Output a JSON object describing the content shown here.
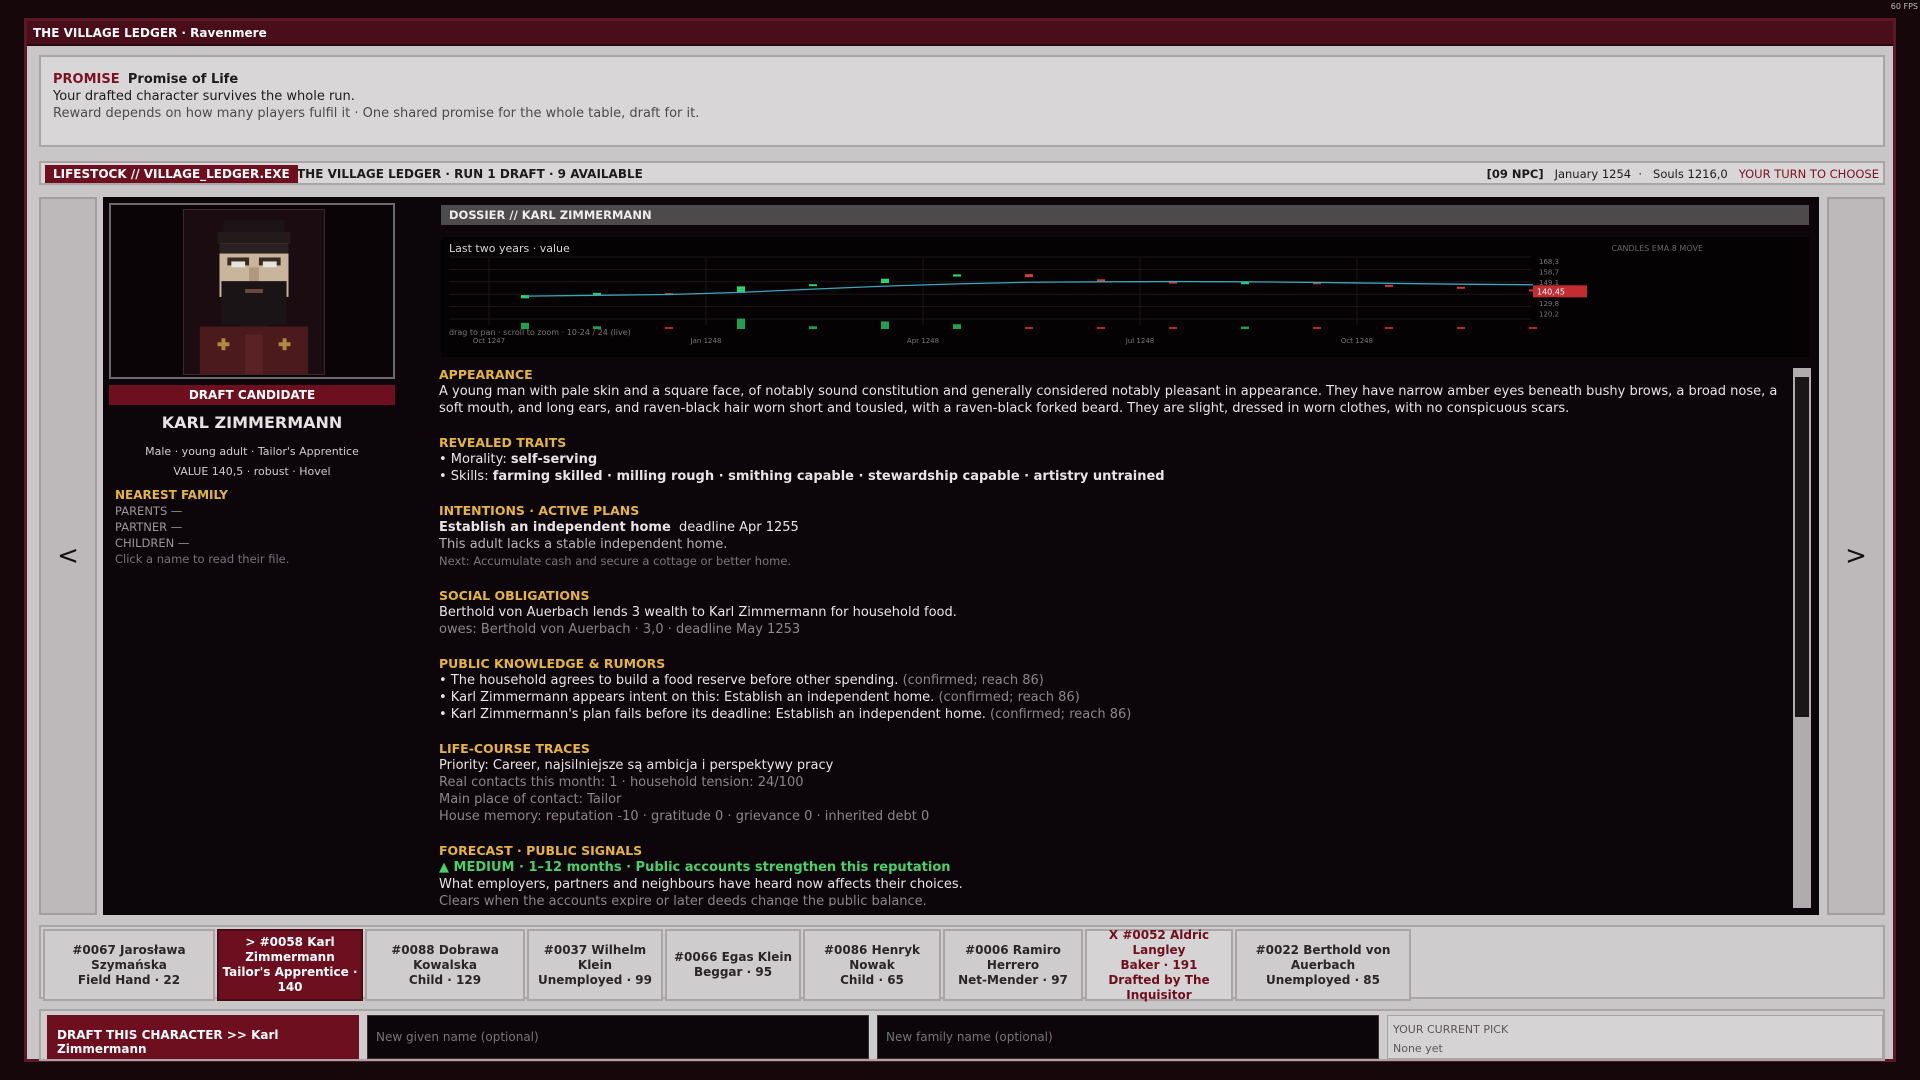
{
  "window": {
    "title": "THE VILLAGE LEDGER · Ravenmere",
    "fps": "60 FPS"
  },
  "promise": {
    "keyword": "PROMISE",
    "title": "Promise of Life",
    "line1": "Your drafted character survives the whole run.",
    "line2": "Reward depends on how many players fulfil it · One shared promise for the whole table, draft for it."
  },
  "status": {
    "exe": "LIFESTOCK // VILLAGE_LEDGER.EXE",
    "run": "THE VILLAGE LEDGER · RUN 1 DRAFT · 9 AVAILABLE",
    "npc": "[09 NPC]",
    "date": "January 1254",
    "souls": "Souls 1216,0",
    "turn": "YOUR TURN TO CHOOSE"
  },
  "nav": {
    "prev": "<",
    "next": ">"
  },
  "candidate": {
    "badge": "DRAFT CANDIDATE",
    "name": "KARL ZIMMERMANN",
    "meta1": "Male · young adult · Tailor's Apprentice",
    "meta2": "VALUE 140,5 · robust · Hovel",
    "family_head": "NEAREST FAMILY",
    "parents": "PARENTS —",
    "partner": "PARTNER —",
    "children": "CHILDREN —",
    "hint": "Click a name to read their file."
  },
  "dossier": {
    "header": "DOSSIER // KARL ZIMMERMANN"
  },
  "chart_data": {
    "type": "candlestick",
    "title": "Last two years · value",
    "modes": "CANDLES  EMA 8  MOVE",
    "x_ticks": [
      "Oct 1247",
      "Jan 1248",
      "Apr 1248",
      "Jul 1248",
      "Oct 1248"
    ],
    "y_ticks": [
      "168,3",
      "158,7",
      "149,1",
      "129,8",
      "120,2"
    ],
    "current_value_label": "140,45",
    "ylim": [
      115,
      172
    ],
    "footer": "drag to pan · scroll to zoom · 10-24 / 24 (live)",
    "candles": [
      {
        "dir": "up",
        "open": 134,
        "close": 137
      },
      {
        "dir": "up",
        "open": 138.5,
        "close": 139
      },
      {
        "dir": "down",
        "open": 138.8,
        "close": 138.4
      },
      {
        "dir": "up",
        "open": 139,
        "close": 145
      },
      {
        "dir": "up",
        "open": 146.5,
        "close": 147
      },
      {
        "dir": "up",
        "open": 148,
        "close": 152
      },
      {
        "dir": "up",
        "open": 154,
        "close": 156
      },
      {
        "dir": "down",
        "open": 156.3,
        "close": 153.5
      },
      {
        "dir": "down",
        "open": 151.5,
        "close": 150
      },
      {
        "dir": "down",
        "open": 149.4,
        "close": 148.6
      },
      {
        "dir": "up",
        "open": 148.5,
        "close": 148.8
      },
      {
        "dir": "down",
        "open": 148.8,
        "close": 147.2
      },
      {
        "dir": "down",
        "open": 146.4,
        "close": 145.8
      },
      {
        "dir": "down",
        "open": 144.6,
        "close": 143.2
      },
      {
        "dir": "down",
        "open": 142.2,
        "close": 141.4
      }
    ],
    "ema": [
      136,
      136.8,
      137.5,
      139.5,
      142.5,
      145.2,
      147.3,
      148.8,
      149.2,
      149.4,
      149.2,
      148.6,
      147.8,
      147,
      146.5
    ]
  },
  "sections": {
    "appearance": {
      "head": "APPEARANCE",
      "text": "A young man with pale skin and a square face, of notably sound constitution and generally considered notably pleasant in appearance. They have narrow amber eyes beneath bushy brows, a broad nose, a soft mouth, and long ears, and raven-black hair worn short and tousled, with a raven-black forked beard. They are slight, dressed in worn clothes, with no conspicuous scars."
    },
    "traits": {
      "head": "REVEALED TRAITS",
      "morality_label": "• Morality: ",
      "morality": "self-serving",
      "skills_label": "• Skills: ",
      "skills": "farming skilled · milling rough · smithing capable · stewardship capable · artistry untrained"
    },
    "intentions": {
      "head": "INTENTIONS · ACTIVE PLANS",
      "plan": "Establish an independent home",
      "deadline": "deadline Apr 1255",
      "reason": "This adult lacks a stable independent home.",
      "next": "Next: Accumulate cash and secure a cottage or better home."
    },
    "obligations": {
      "head": "SOCIAL OBLIGATIONS",
      "line1": "Berthold von Auerbach lends 3 wealth to Karl Zimmermann for household food.",
      "line2": "owes: Berthold von Auerbach · 3,0 · deadline May 1253"
    },
    "rumors": {
      "head": "PUBLIC KNOWLEDGE & RUMORS",
      "items": [
        {
          "text": "• The household agrees to build a food reserve before other spending.",
          "note": "(confirmed; reach 86)"
        },
        {
          "text": "• Karl Zimmermann appears intent on this: Establish an independent home.",
          "note": "(confirmed; reach 86)"
        },
        {
          "text": "• Karl Zimmermann's plan fails before its deadline: Establish an independent home.",
          "note": "(confirmed; reach 86)"
        }
      ]
    },
    "lifecourse": {
      "head": "LIFE-COURSE TRACES",
      "priority": "Priority: Career, najsilniejsze są ambicja i perspektywy pracy",
      "contacts": "Real contacts this month: 1 · household tension: 24/100",
      "place": "Main place of contact: Tailor",
      "memory": "House memory: reputation -10 · gratitude 0 · grievance 0 · inherited debt 0"
    },
    "forecast": {
      "head": "FORECAST · PUBLIC SIGNALS",
      "signal": "▲ MEDIUM · 1–12 months · Public accounts strengthen this reputation",
      "line1": "What employers, partners and neighbours have heard now affects their choices.",
      "line2": "Clears when the accounts expire or later deeds change the public balance."
    }
  },
  "cards": [
    {
      "line1": "#0067  Jarosława Szymańska",
      "line2": "Field Hand · 22"
    },
    {
      "line1": "> #0058  Karl Zimmermann",
      "line2": "Tailor's Apprentice · 140"
    },
    {
      "line1": "#0088  Dobrawa Kowalska",
      "line2": "Child · 129"
    },
    {
      "line1": "#0037  Wilhelm Klein",
      "line2": "Unemployed · 99"
    },
    {
      "line1": "#0066  Egas Klein",
      "line2": "Beggar · 95"
    },
    {
      "line1": "#0086  Henryk Nowak",
      "line2": "Child · 65"
    },
    {
      "line1": "#0006  Ramiro Herrero",
      "line2": "Net-Mender · 97"
    },
    {
      "line1": "X #0052  Aldric Langley",
      "line2": "Baker · 191",
      "line3": "Drafted by The Inquisitor"
    },
    {
      "line1": "#0022  Berthold von Auerbach",
      "line2": "Unemployed · 85"
    }
  ],
  "bottom": {
    "draft_button": "DRAFT THIS CHARACTER  >>  Karl Zimmermann",
    "given_placeholder": "New given name (optional)",
    "family_placeholder": "New family name (optional)",
    "pick_label": "YOUR CURRENT PICK",
    "pick_value": "None yet"
  },
  "colors": {
    "accent": "#6e0f20",
    "gold": "#e5b43c",
    "up": "#2bd36a",
    "down": "#d43a3a",
    "ema": "#3aa6b8"
  }
}
